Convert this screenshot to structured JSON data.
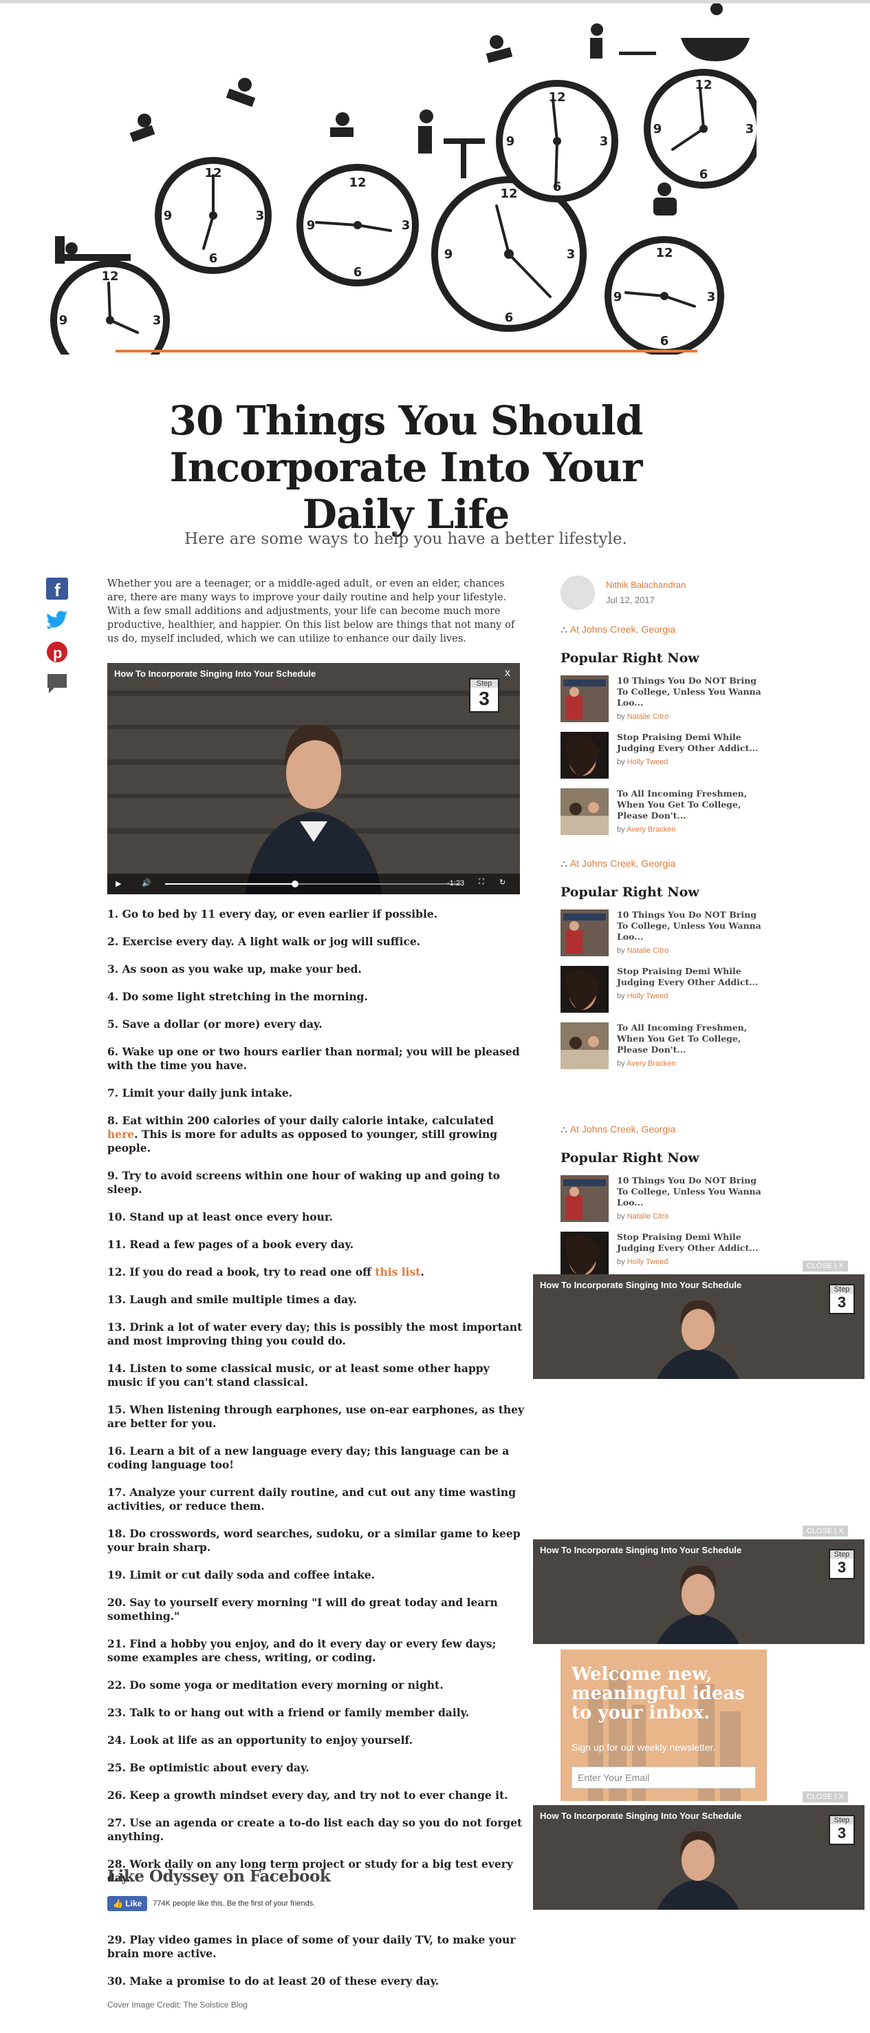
{
  "article": {
    "title": "30 Things You Should Incorporate Into Your Daily Life",
    "subtitle": "Here are some ways to help you have a better lifestyle.",
    "intro": "Whether you are a teenager, or a middle-aged adult, or even an elder, chances are, there are many ways to improve your daily routine and help your lifestyle. With a few small additions and adjustments, your life can become much more productive, healthier, and happier. On this list below are things that not many of us do, myself included, which we can utilize to enhance our daily lives.",
    "items": [
      "1. Go to bed by 11 every day, or even earlier if possible.",
      "2. Exercise every day. A light walk or jog will suffice.",
      "3. As soon as you wake up, make your bed.",
      "4. Do some light stretching in the morning.",
      "5. Save a dollar (or more) every day.",
      "6. Wake up one or two hours earlier than normal; you will be pleased with the time you have.",
      "7. Limit your daily junk intake.",
      "8. Eat within 200 calories of your daily calorie intake, calculated",
      "9. Try to avoid screens within one hour of waking up and going to sleep.",
      "10. Stand up at least once every hour.",
      "11. Read a few pages of a book every day.",
      "12. If you do read a book, try to read one off",
      "13. Laugh and smile multiple times a day.",
      "13. Drink a lot of water every day; this is possibly the most important and most improving thing you could do.",
      "14. Listen to some classical music, or at least some other happy music if you can't stand classical.",
      "15. When listening through earphones, use on-ear earphones, as they are better for you.",
      "16. Learn a bit of a new language every day; this language can be a coding language too!",
      "17. Analyze your current daily routine, and cut out any time wasting activities, or reduce them.",
      "18. Do crosswords, word searches, sudoku, or a similar game to keep your brain sharp.",
      "19. Limit or cut daily soda and coffee intake.",
      "20. Say to yourself every morning \"I will do great today and learn something.\"",
      "21. Find a hobby you enjoy, and do it every day or every few days; some examples are chess, writing, or coding.",
      "22. Do some yoga or meditation every morning or night.",
      "23. Talk to or hang out with a friend or family member daily.",
      "24. Look at life as an opportunity to enjoy yourself.",
      "25. Be optimistic about every day.",
      "26. Keep a growth mindset every day, and try not to ever change it.",
      "27. Use an agenda or create a to-do list each day so you do not forget anything.",
      "28. Work daily on any long term project or study for a big test every day."
    ],
    "item8_link": "here",
    "item8_rest": "This is more for adults as opposed to younger, still growing people.",
    "item12_link": "this list",
    "items_after": [
      "29. Play video games in place of some of your daily TV, to make your brain more active.",
      "30. Make a promise to do at least 20 of these every day."
    ],
    "cover_credit": "Cover Image Credit: The Solstice Blog"
  },
  "video": {
    "title": "How To Incorporate Singing Into Your Schedule",
    "step_label": "Step",
    "step_number": "3",
    "time": "-1:23",
    "close": "x",
    "progress": 0.44
  },
  "facebook": {
    "heading": "Like Odyssey on Facebook",
    "button": "Like",
    "count_text": "774K people like this. Be the first of your friends."
  },
  "author": {
    "name": "Nithik Balachandran",
    "date": "Jul 12, 2017"
  },
  "sidebar": {
    "location": "At Johns Creek, Georgia",
    "popular_heading": "Popular Right Now",
    "by": "by",
    "popular": [
      {
        "title": "10 Things You Do NOT Bring To College, Unless You Wanna Loo...",
        "author": "Natalie Citro"
      },
      {
        "title": "Stop Praising Demi While Judging Every Other Addict...",
        "author": "Holly Tweed"
      },
      {
        "title": "To All Incoming Freshmen, When You Get To College, Please Don't...",
        "author": "Avery Bracken"
      }
    ]
  },
  "float_close": "CLOSE | X",
  "newsletter": {
    "title": "Welcome new, meaningful ideas to your inbox.",
    "subtitle": "Sign up for our weekly newsletter.",
    "placeholder": "Enter Your Email"
  },
  "colors": {
    "accent": "#e07b3a",
    "facebook": "#4267b2",
    "twitter": "#1da1f2",
    "pinterest": "#cb2027"
  }
}
